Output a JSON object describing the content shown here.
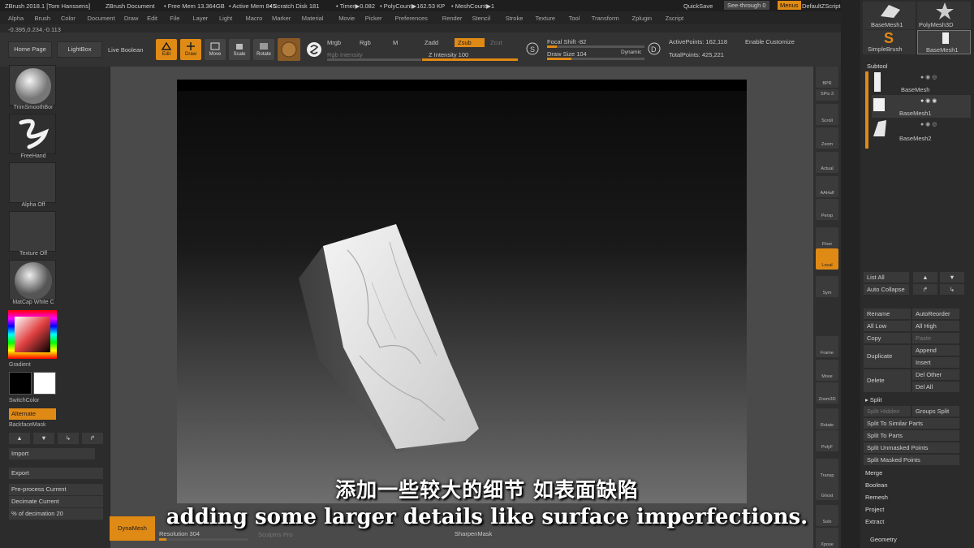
{
  "titlebar": {
    "app": "ZBrush 2018.1 [Tom Hanssens]",
    "doc": "ZBrush Document",
    "free_mem": "• Free Mem 13.364GB",
    "active_mem": "• Active Mem 845",
    "scratch": "• Scratch Disk 181",
    "timer": "• Timer▶0.082",
    "polycount": "• PolyCount▶162.53 KP",
    "meshcount": "• MeshCount▶1",
    "quicksave": "QuickSave",
    "seethrough": "See-through  0",
    "menus": "Menus",
    "script": "DefaultZScript"
  },
  "menubar": [
    "Alpha",
    "Brush",
    "Color",
    "Document",
    "Draw",
    "Edit",
    "File",
    "Layer",
    "Light",
    "Macro",
    "Marker",
    "Material",
    "Movie",
    "Picker",
    "Preferences",
    "Render",
    "Stencil",
    "Stroke",
    "Texture",
    "Tool",
    "Transform",
    "Zplugin",
    "Zscript"
  ],
  "coords": "-0.395,0.234,-0.113",
  "shelf": {
    "home": "Home Page",
    "lightbox": "LightBox",
    "live_boolean": "Live Boolean",
    "tools": [
      {
        "label": "Edit",
        "on": true
      },
      {
        "label": "Draw",
        "on": true
      },
      {
        "label": "Move",
        "on": false
      },
      {
        "label": "Scale",
        "on": false
      },
      {
        "label": "Rotate",
        "on": false
      }
    ],
    "mrgb": "Mrgb",
    "rgb": "Rgb",
    "m": "M",
    "rgb_intensity": "Rgb Intensity",
    "zadd": "Zadd",
    "zsub": "Zsub",
    "zcut": "Zcut",
    "z_intensity": "Z Intensity 100",
    "focal_shift": "Focal Shift -82",
    "draw_size": "Draw Size 104",
    "dynamic": "Dynamic",
    "active_points": "ActivePoints: 162,118",
    "total_points": "TotalPoints: 425,221",
    "enable_customize": "Enable Customize"
  },
  "left": {
    "brush": "TrimSmoothBor",
    "stroke": "FreeHand",
    "alpha": "Alpha Off",
    "texture": "Texture Off",
    "material": "MatCap White C",
    "gradient": "Gradient",
    "switchcolor": "SwitchColor",
    "alternate": "Alternate",
    "backface": "BackfaceMask",
    "import": "Import",
    "export": "Export",
    "preprocess": "Pre-process Current",
    "decimate": "Decimate Current",
    "pct_decimation": "% of decimation 20"
  },
  "bottom": {
    "dynamesh": "DynaMesh",
    "resolution": "Resolution 304",
    "sculptris": "Sculptris Pro",
    "sharpen": "SharpenMask"
  },
  "rcol": [
    {
      "label": "BPR",
      "on": false
    },
    {
      "label": "SPix 3",
      "on": false
    },
    {
      "label": "Scroll",
      "on": false
    },
    {
      "label": "Zoom",
      "on": false
    },
    {
      "label": "Actual",
      "on": false
    },
    {
      "label": "AAHalf",
      "on": false
    },
    {
      "label": "Persp",
      "on": false
    },
    {
      "label": "Floor",
      "on": false
    },
    {
      "label": "Local",
      "on": true
    },
    {
      "label": "Sym",
      "on": false
    },
    {
      "label": "Frame",
      "on": false
    },
    {
      "label": "Move",
      "on": false
    },
    {
      "label": "Zoom3D",
      "on": false
    },
    {
      "label": "Rotate",
      "on": false
    },
    {
      "label": "PolyF",
      "on": false
    },
    {
      "label": "Transp",
      "on": false
    },
    {
      "label": "Ghost",
      "on": false
    },
    {
      "label": "Solo",
      "on": false
    },
    {
      "label": "Xpose",
      "on": false
    }
  ],
  "tray": {
    "tool_top": [
      "BaseMesh1",
      "PolyMesh3D",
      "SimpleBrush",
      "BaseMesh1"
    ],
    "subtool": "Subtool",
    "subtools": [
      "BaseMesh",
      "BaseMesh1",
      "BaseMesh2"
    ],
    "list_all": "List All",
    "auto_collapse": "Auto Collapse",
    "rename": "Rename",
    "autoreorder": "AutoReorder",
    "all_low": "All Low",
    "all_high": "All High",
    "copy": "Copy",
    "paste": "Paste",
    "duplicate": "Duplicate",
    "append": "Append",
    "insert": "Insert",
    "delete": "Delete",
    "del_other": "Del Other",
    "del_all": "Del All",
    "split": "▸ Split",
    "split_hidden": "Split Hidden",
    "groups_split": "Groups Split",
    "split_similar": "Split To Similar Parts",
    "split_parts": "Split To Parts",
    "split_unmasked": "Split Unmasked Points",
    "split_masked": "Split Masked Points",
    "merge": "Merge",
    "boolean": "Boolean",
    "remesh": "Remesh",
    "project": "Project",
    "extract": "Extract",
    "geometry": "Geometry"
  },
  "subtitle_zh": "添加一些较大的细节 如表面缺陷",
  "subtitle_en": "adding some larger details like surface imperfections.",
  "colors": {
    "accent": "#e08a16",
    "panel": "#2c2c2c",
    "canvas_border": "#4a4a4a"
  }
}
